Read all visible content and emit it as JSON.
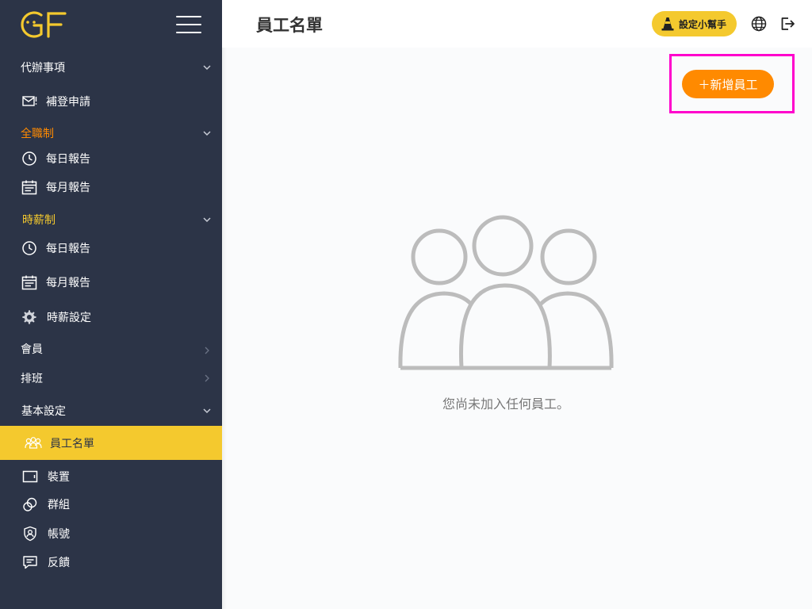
{
  "app": {
    "logo_text": "GF"
  },
  "header": {
    "title": "員工名單",
    "helper_label": "設定小幫手"
  },
  "sidebar": {
    "sections": [
      {
        "label": "代辦事項"
      },
      {
        "label": "補登申請"
      },
      {
        "label": "全職制"
      },
      {
        "label": "每日報告"
      },
      {
        "label": "每月報告"
      },
      {
        "label": "時薪制"
      },
      {
        "label": "每日報告"
      },
      {
        "label": "每月報告"
      },
      {
        "label": "時薪設定"
      },
      {
        "label": "會員"
      },
      {
        "label": "排班"
      },
      {
        "label": "基本設定"
      },
      {
        "label": "員工名單"
      },
      {
        "label": "裝置"
      },
      {
        "label": "群組"
      },
      {
        "label": "帳號"
      },
      {
        "label": "反饋"
      }
    ]
  },
  "main": {
    "add_button_label": "＋新增員工",
    "empty_message": "您尚未加入任何員工。"
  },
  "colors": {
    "sidebar_bg": "#2c3447",
    "accent_yellow": "#f4c92e",
    "accent_orange": "#ff8a00",
    "highlight": "#ff00cc"
  }
}
